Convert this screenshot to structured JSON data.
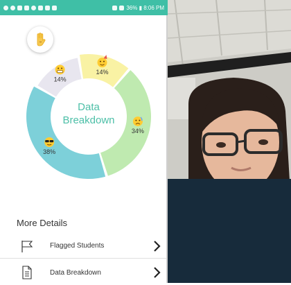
{
  "status_bar": {
    "left_icons": [
      "signal-icon",
      "notification-icon",
      "image-icon",
      "message-icon",
      "gear-icon",
      "app-icon"
    ],
    "right_text": "36% ▮ 8:06 PM"
  },
  "donut": {
    "center_label": "Data Breakdown",
    "segments": [
      {
        "name": "grimace",
        "value": 14,
        "label": "14%",
        "color": "#e8e6ef"
      },
      {
        "name": "party",
        "value": 14,
        "label": "14%",
        "color": "#f9f2a4"
      },
      {
        "name": "sad",
        "value": 34,
        "label": "34%",
        "color": "#bfeab0"
      },
      {
        "name": "cool",
        "value": 38,
        "label": "38%",
        "color": "#7dd0d9"
      }
    ]
  },
  "chart_data": {
    "type": "pie",
    "categories": [
      "grimace",
      "party",
      "sad",
      "cool"
    ],
    "values": [
      14,
      14,
      34,
      38
    ],
    "title": "Data Breakdown"
  },
  "more_details": {
    "heading": "More Details",
    "items": [
      {
        "label": "Flagged Students"
      },
      {
        "label": "Data Breakdown"
      }
    ]
  },
  "colors": {
    "accent": "#3fbfa6",
    "center_text": "#4cbfa7"
  }
}
